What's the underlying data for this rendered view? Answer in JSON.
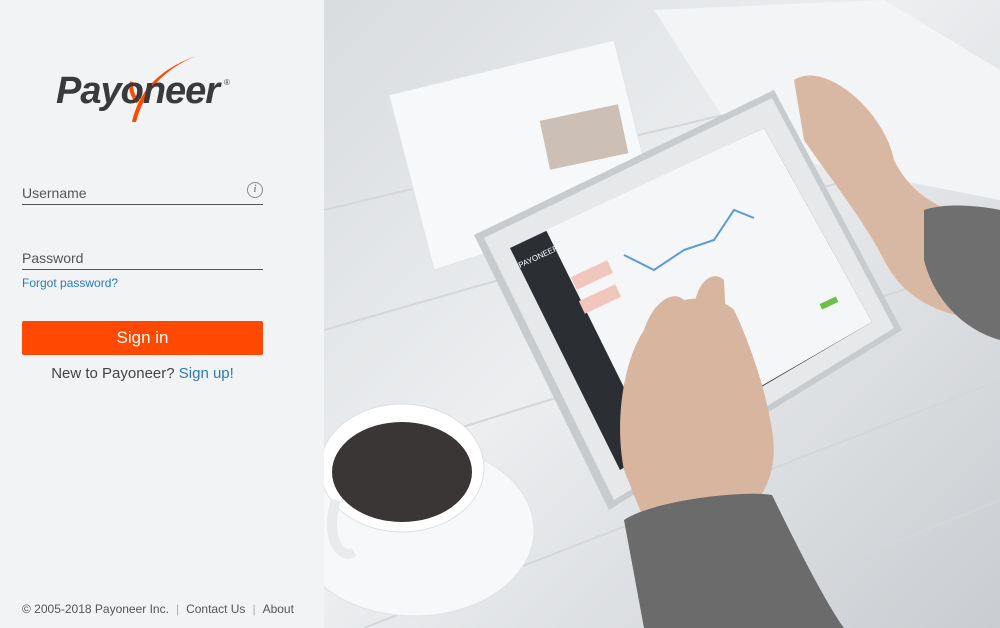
{
  "brand": {
    "logo_text": "Payoneer",
    "accent_color": "#ff4800",
    "link_color": "#2a7bb8"
  },
  "login": {
    "username_label": "Username",
    "password_label": "Password",
    "forgot_link": "Forgot password?",
    "sign_in_button": "Sign in",
    "new_user_text": "New to Payoneer?",
    "sign_up_link": "Sign up!"
  },
  "footer": {
    "copyright": "© 2005-2018 Payoneer Inc.",
    "contact_link": "Contact Us",
    "about_link": "About"
  },
  "hero": {
    "tablet_brand": "PAYONEER"
  }
}
